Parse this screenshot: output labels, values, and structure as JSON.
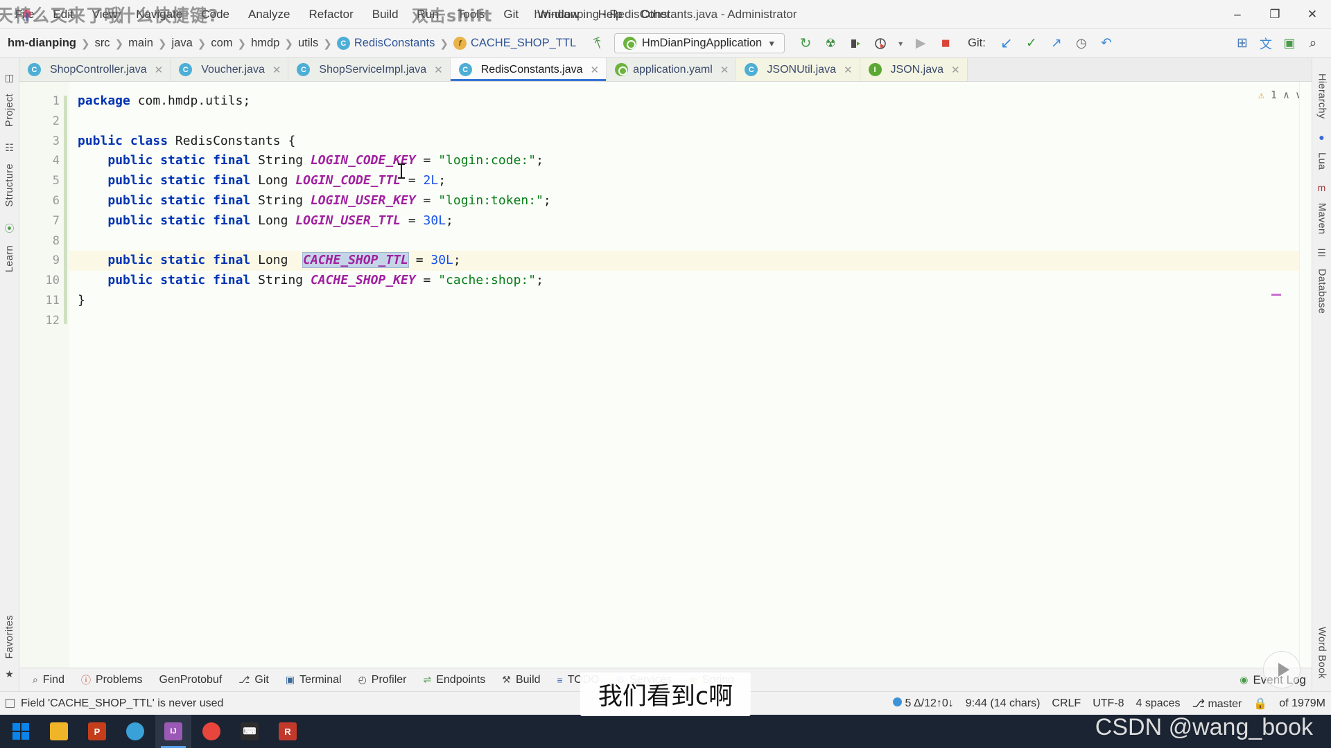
{
  "window": {
    "title": "hm-dianping - RedisConstants.java - Administrator",
    "minimize_label": "–",
    "maximize_label": "❐",
    "close_label": "✕"
  },
  "menu": {
    "items": [
      {
        "label": "File"
      },
      {
        "label": "Edit"
      },
      {
        "label": "View"
      },
      {
        "label": "Navigate"
      },
      {
        "label": "Code"
      },
      {
        "label": "Analyze"
      },
      {
        "label": "Refactor"
      },
      {
        "label": "Build"
      },
      {
        "label": "Run"
      },
      {
        "label": "Tools"
      },
      {
        "label": "Git"
      },
      {
        "label": "Window"
      },
      {
        "label": "Help"
      },
      {
        "label": "Other"
      }
    ],
    "annotations": [
      {
        "text": "天特么又来了哦"
      },
      {
        "text": "什么快捷键?"
      },
      {
        "text": "双击shift"
      }
    ]
  },
  "breadcrumb": {
    "items": [
      {
        "label": "hm-dianping",
        "kind": "module"
      },
      {
        "label": "src",
        "kind": "folder"
      },
      {
        "label": "main",
        "kind": "folder"
      },
      {
        "label": "java",
        "kind": "folder"
      },
      {
        "label": "com",
        "kind": "folder"
      },
      {
        "label": "hmdp",
        "kind": "folder"
      },
      {
        "label": "utils",
        "kind": "folder"
      },
      {
        "label": "RedisConstants",
        "kind": "class",
        "icon": "C"
      },
      {
        "label": "CACHE_SHOP_TTL",
        "kind": "field",
        "icon": "f"
      }
    ]
  },
  "toolbar": {
    "run_config": "HmDianPingApplication",
    "run_config_caret": "▼",
    "git_label": "Git:",
    "icons": [
      {
        "name": "rerun-icon",
        "glyph": "↻",
        "color": "#4a9a4a"
      },
      {
        "name": "debug-icon",
        "glyph": "☢",
        "color": "#3d8b3d"
      },
      {
        "name": "run-with-coverage-icon",
        "glyph": "▶",
        "color": "#3a3a3a"
      },
      {
        "name": "profiler-icon",
        "glyph": "◴",
        "color": "#3a3a3a"
      },
      {
        "name": "profiler-dropdown-icon",
        "glyph": "▾",
        "color": "#6a6a6a"
      },
      {
        "name": "run-icon",
        "glyph": "▶",
        "color": "#a8a8a8"
      },
      {
        "name": "stop-icon",
        "glyph": "■",
        "color": "#db4437"
      }
    ],
    "git_icons": [
      {
        "name": "git-update-icon",
        "glyph": "↙",
        "color": "#3d8ad8"
      },
      {
        "name": "git-commit-icon",
        "glyph": "✓",
        "color": "#3d9a3d"
      },
      {
        "name": "git-push-icon",
        "glyph": "↗",
        "color": "#3d8ad8"
      },
      {
        "name": "git-history-icon",
        "glyph": "◷",
        "color": "#5a5a5a"
      },
      {
        "name": "git-rollback-icon",
        "glyph": "↶",
        "color": "#3d8ad8"
      }
    ],
    "right_icons": [
      {
        "name": "services-icon",
        "glyph": "⊞",
        "color": "#4a7ab8"
      },
      {
        "name": "translate-icon",
        "glyph": "文",
        "color": "#3d8ad8"
      },
      {
        "name": "terminal-icon",
        "glyph": "▣",
        "color": "#4a9a4a"
      },
      {
        "name": "search-everywhere-icon",
        "glyph": "⌕",
        "color": "#4a4a4a"
      }
    ]
  },
  "left_strip": {
    "items": [
      {
        "label": "Project",
        "icon": "project-icon"
      },
      {
        "label": "Structure",
        "icon": "structure-icon"
      },
      {
        "label": "Learn",
        "icon": "learn-icon"
      }
    ],
    "bottom_items": [
      {
        "label": "Favorites",
        "icon": "star-icon"
      }
    ]
  },
  "right_strip": {
    "items": [
      {
        "label": "Hierarchy",
        "icon": "hierarchy-icon"
      },
      {
        "label": "Lua",
        "icon": "lua-icon"
      },
      {
        "label": "Maven",
        "icon": "maven-icon"
      },
      {
        "label": "Database",
        "icon": "database-icon"
      }
    ],
    "bottom_items": [
      {
        "label": "Word Book",
        "icon": "book-icon"
      }
    ]
  },
  "tabs": [
    {
      "label": "ShopController.java",
      "icon": "C",
      "type": "class",
      "active": false,
      "close": "✕"
    },
    {
      "label": "Voucher.java",
      "icon": "C",
      "type": "class",
      "active": false,
      "close": "✕"
    },
    {
      "label": "ShopServiceImpl.java",
      "icon": "C",
      "type": "class",
      "active": false,
      "close": "✕"
    },
    {
      "label": "RedisConstants.java",
      "icon": "C",
      "type": "class",
      "active": true,
      "close": "✕"
    },
    {
      "label": "application.yaml",
      "icon": "spring",
      "type": "yaml",
      "active": false,
      "close": "✕"
    },
    {
      "label": "JSONUtil.java",
      "icon": "C",
      "type": "library-class",
      "active": false,
      "close": "✕"
    },
    {
      "label": "JSON.java",
      "icon": "I",
      "type": "library-interface",
      "active": false,
      "close": "✕"
    }
  ],
  "editor": {
    "line_numbers": [
      "1",
      "2",
      "3",
      "4",
      "5",
      "6",
      "7",
      "8",
      "9",
      "10",
      "11",
      "12"
    ],
    "highlight_line": 9,
    "selection_text": "CACHE_SHOP_TTL",
    "warning_count": "1",
    "warning_glyph": "⚠",
    "code_lines": [
      {
        "n": 1,
        "tokens": [
          {
            "t": "package",
            "c": "kw"
          },
          {
            "t": " com.hmdp.utils",
            "c": "pun"
          },
          {
            "t": ";",
            "c": "pun"
          }
        ]
      },
      {
        "n": 2,
        "tokens": []
      },
      {
        "n": 3,
        "tokens": [
          {
            "t": "public ",
            "c": "kw"
          },
          {
            "t": "class ",
            "c": "kw"
          },
          {
            "t": "RedisConstants",
            "c": "type"
          },
          {
            "t": " {",
            "c": "pun"
          }
        ]
      },
      {
        "n": 4,
        "tokens": [
          {
            "t": "    ",
            "c": "pun"
          },
          {
            "t": "public static final ",
            "c": "kw"
          },
          {
            "t": "String ",
            "c": "type"
          },
          {
            "t": "LOGIN_CODE_KEY",
            "c": "const"
          },
          {
            "t": " = ",
            "c": "pun"
          },
          {
            "t": "\"login:code:\"",
            "c": "str"
          },
          {
            "t": ";",
            "c": "pun"
          }
        ]
      },
      {
        "n": 5,
        "tokens": [
          {
            "t": "    ",
            "c": "pun"
          },
          {
            "t": "public static final ",
            "c": "kw"
          },
          {
            "t": "Long ",
            "c": "type"
          },
          {
            "t": "LOGIN_CODE_TTL",
            "c": "const"
          },
          {
            "t": " = ",
            "c": "pun"
          },
          {
            "t": "2L",
            "c": "num"
          },
          {
            "t": ";",
            "c": "pun"
          }
        ]
      },
      {
        "n": 6,
        "tokens": [
          {
            "t": "    ",
            "c": "pun"
          },
          {
            "t": "public static final ",
            "c": "kw"
          },
          {
            "t": "String ",
            "c": "type"
          },
          {
            "t": "LOGIN_USER_KEY",
            "c": "const"
          },
          {
            "t": " = ",
            "c": "pun"
          },
          {
            "t": "\"login:token:\"",
            "c": "str"
          },
          {
            "t": ";",
            "c": "pun"
          }
        ]
      },
      {
        "n": 7,
        "tokens": [
          {
            "t": "    ",
            "c": "pun"
          },
          {
            "t": "public static final ",
            "c": "kw"
          },
          {
            "t": "Long ",
            "c": "type"
          },
          {
            "t": "LOGIN_USER_TTL",
            "c": "const"
          },
          {
            "t": " = ",
            "c": "pun"
          },
          {
            "t": "30L",
            "c": "num"
          },
          {
            "t": ";",
            "c": "pun"
          }
        ]
      },
      {
        "n": 8,
        "tokens": []
      },
      {
        "n": 9,
        "tokens": [
          {
            "t": "    ",
            "c": "pun"
          },
          {
            "t": "public static final ",
            "c": "kw"
          },
          {
            "t": "Long  ",
            "c": "type"
          },
          {
            "t": "CACHE_SHOP_TTL",
            "c": "const sel"
          },
          {
            "t": " = ",
            "c": "pun"
          },
          {
            "t": "30L",
            "c": "num"
          },
          {
            "t": ";",
            "c": "pun"
          }
        ]
      },
      {
        "n": 10,
        "tokens": [
          {
            "t": "    ",
            "c": "pun"
          },
          {
            "t": "public static final ",
            "c": "kw"
          },
          {
            "t": "String ",
            "c": "type"
          },
          {
            "t": "CACHE_SHOP_KEY",
            "c": "const"
          },
          {
            "t": " = ",
            "c": "pun"
          },
          {
            "t": "\"cache:shop:\"",
            "c": "str"
          },
          {
            "t": ";",
            "c": "pun"
          }
        ]
      },
      {
        "n": 11,
        "tokens": [
          {
            "t": "}",
            "c": "pun"
          }
        ]
      },
      {
        "n": 12,
        "tokens": []
      }
    ]
  },
  "bottom_tools": [
    {
      "label": "Find",
      "icon": "⌕"
    },
    {
      "label": "Problems",
      "icon": "ⓘ"
    },
    {
      "label": "GenProtobuf",
      "icon": ""
    },
    {
      "label": "Git",
      "icon": "⎇"
    },
    {
      "label": "Terminal",
      "icon": "▣"
    },
    {
      "label": "Profiler",
      "icon": "◴"
    },
    {
      "label": "Endpoints",
      "icon": "⇌"
    },
    {
      "label": "Build",
      "icon": "⚒"
    },
    {
      "label": "TODO",
      "icon": "≡"
    },
    {
      "label": "Services",
      "icon": "⚙"
    },
    {
      "label": "Spring",
      "icon": "◉"
    }
  ],
  "bottom_right": {
    "event_log_label": "Event Log",
    "event_log_icon": "◉"
  },
  "status": {
    "message": "Field 'CACHE_SHOP_TTL' is never used",
    "vcs_changes": "5 Δ/12↑0↓",
    "caret_position": "9:44 (14 chars)",
    "line_separator": "CRLF",
    "encoding": "UTF-8",
    "indent": "4 spaces",
    "branch": "master",
    "branch_icon": "⎇",
    "memory": "of 1979M",
    "lock_icon": "ὑ2"
  },
  "overlays": {
    "subtitle": "我们看到c啊",
    "watermark": "CSDN @wang_book"
  },
  "taskbar": {
    "apps": [
      {
        "name": "start-button",
        "label": "⊞",
        "color": "#0a84e8"
      },
      {
        "name": "file-explorer",
        "label": "🗀",
        "color": "#f0b429"
      },
      {
        "name": "powerpoint",
        "label": "P",
        "color": "#c43e1c"
      },
      {
        "name": "browser",
        "label": "◔",
        "color": "#3aa0d8"
      },
      {
        "name": "intellij-idea",
        "label": "IJ",
        "color": "#9b59b6"
      },
      {
        "name": "chrome",
        "label": "◎",
        "color": "#e8453c"
      },
      {
        "name": "terminal",
        "label": "⌨",
        "color": "#2d2d2d"
      },
      {
        "name": "redis-desktop",
        "label": "R",
        "color": "#c0392b"
      }
    ]
  }
}
